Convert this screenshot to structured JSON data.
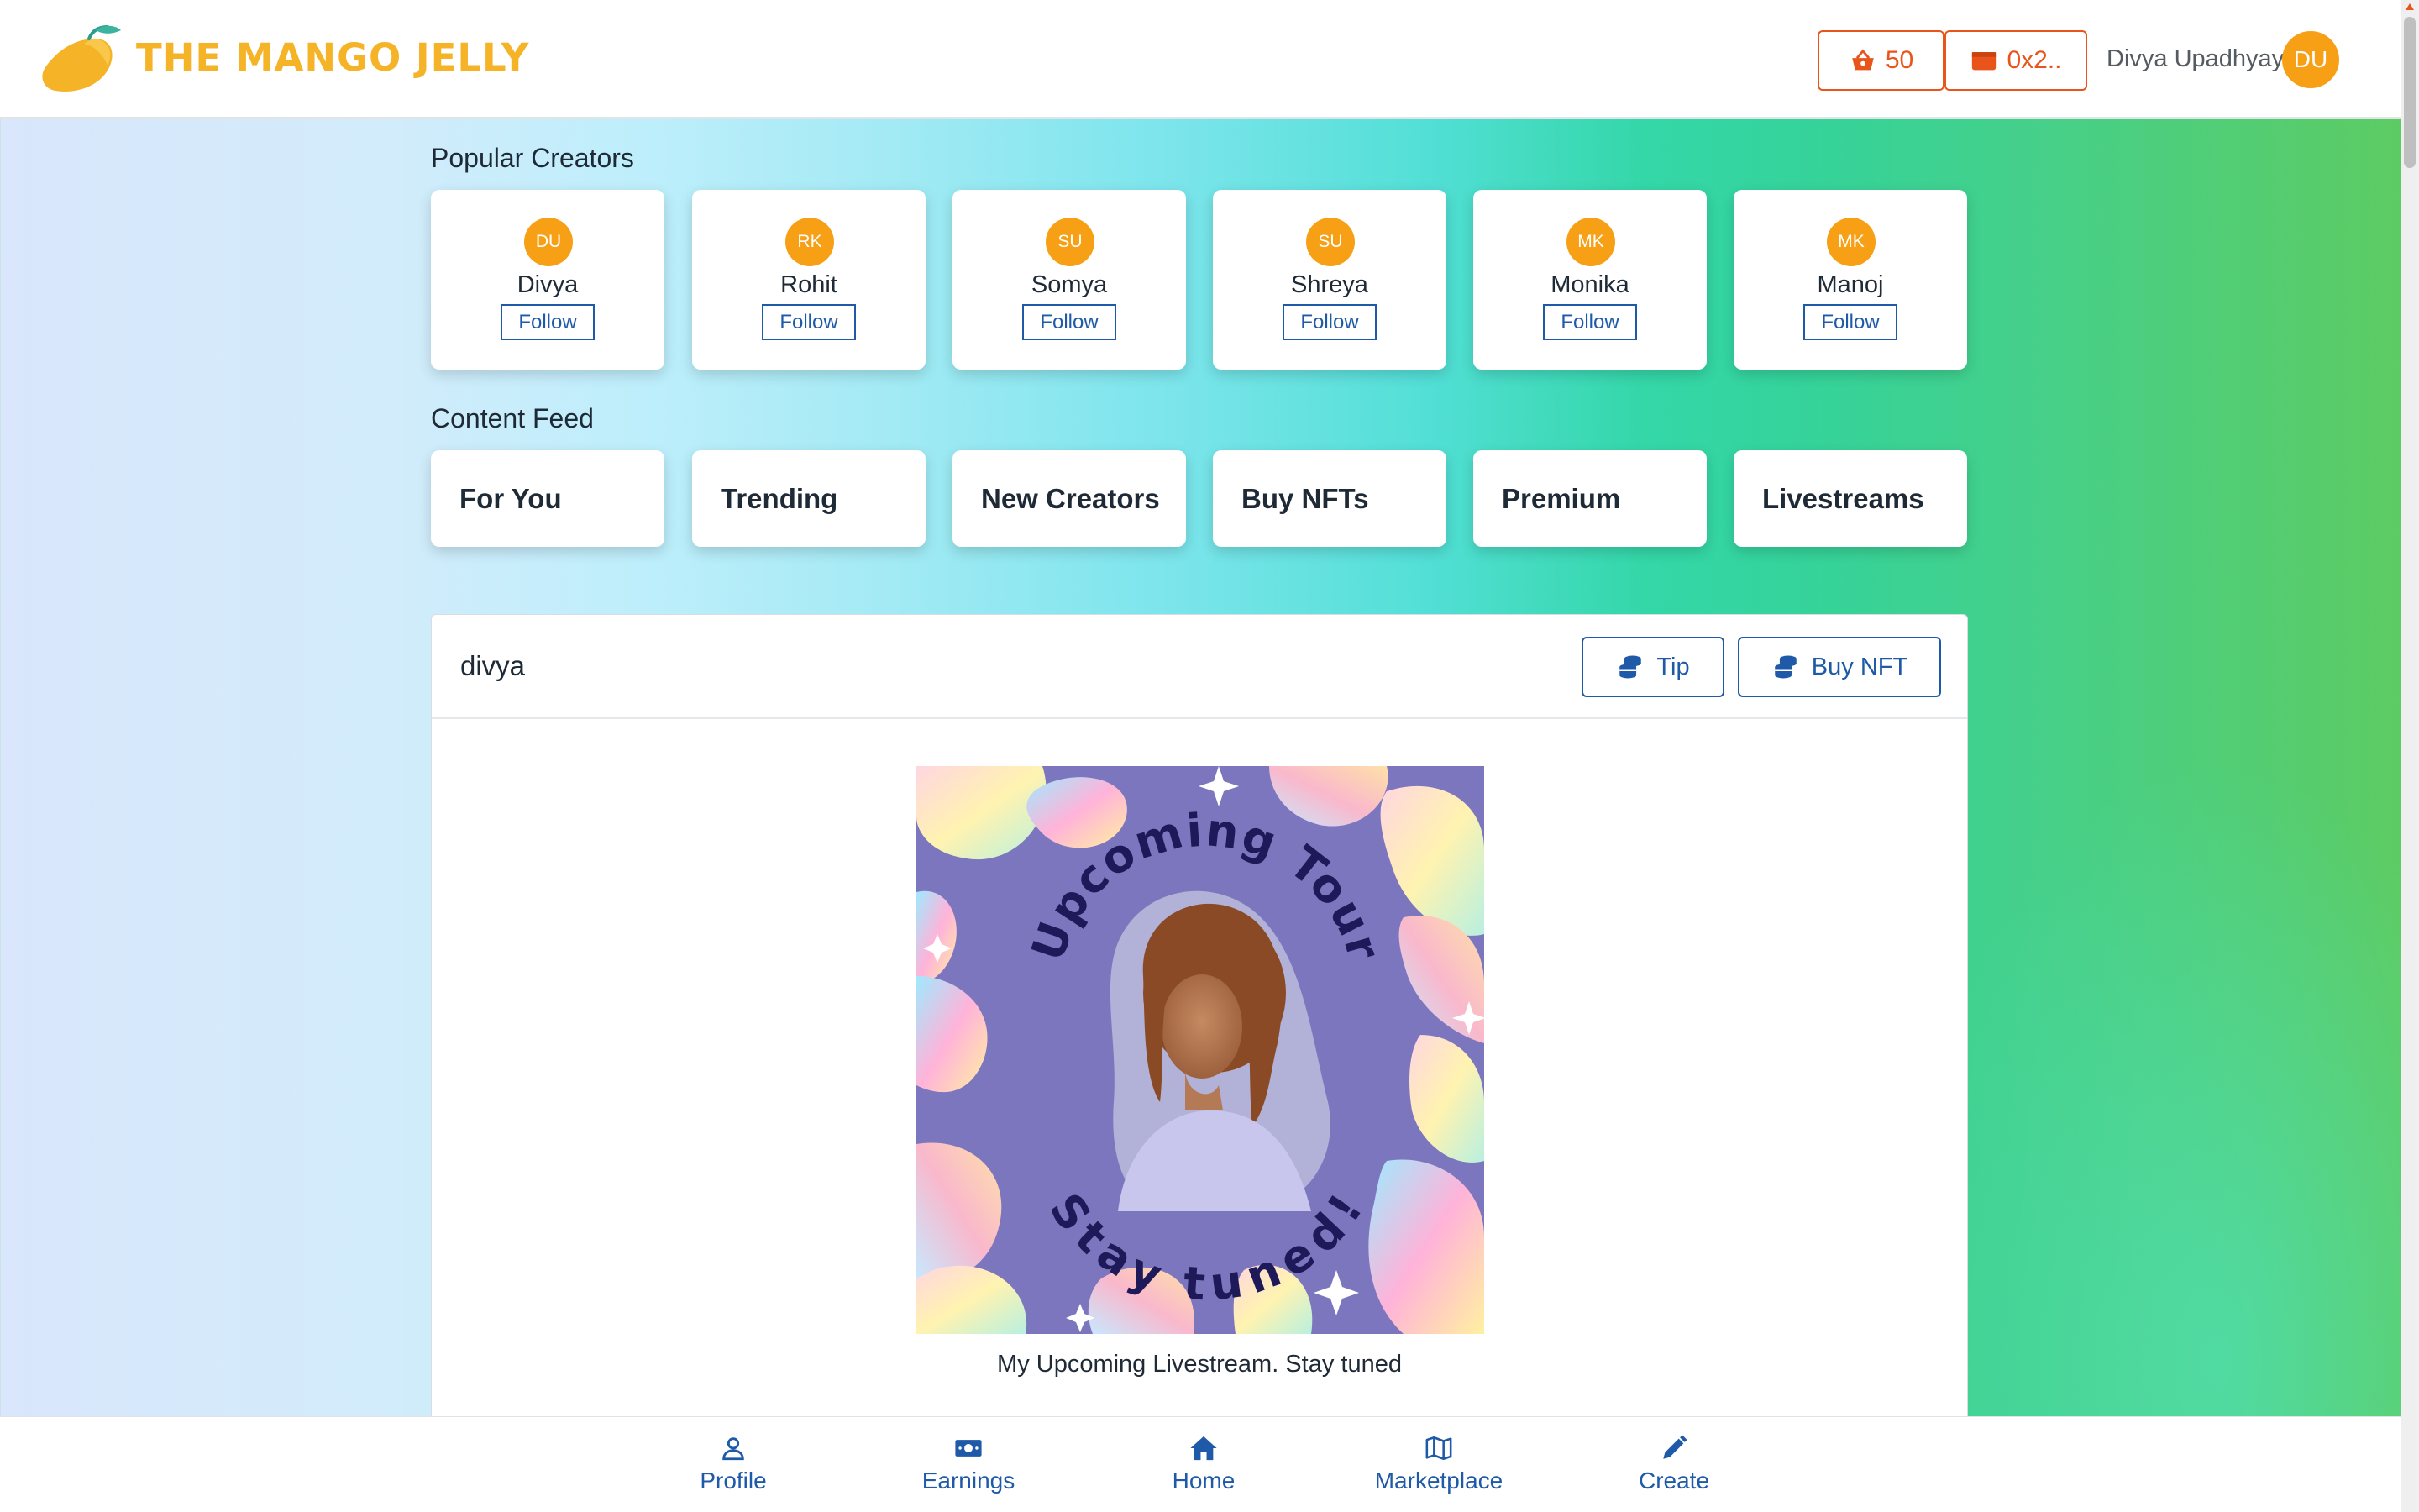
{
  "header": {
    "brand": "THE MANGO JELLY",
    "points": "50",
    "wallet": "0x2..",
    "username": "Divya Upadhyay",
    "avatar_initials": "DU"
  },
  "popular_creators": {
    "title": "Popular Creators",
    "follow_label": "Follow",
    "items": [
      {
        "initials": "DU",
        "name": "Divya",
        "follow": "Follow"
      },
      {
        "initials": "RK",
        "name": "Rohit",
        "follow": "Follow"
      },
      {
        "initials": "SU",
        "name": "Somya",
        "follow": "Follow"
      },
      {
        "initials": "SU",
        "name": "Shreya",
        "follow": "Follow"
      },
      {
        "initials": "MK",
        "name": "Monika",
        "follow": "Follow"
      },
      {
        "initials": "MK",
        "name": "Manoj",
        "follow": "Follow"
      }
    ]
  },
  "content_feed": {
    "title": "Content Feed",
    "tabs": [
      {
        "label": "For You"
      },
      {
        "label": "Trending"
      },
      {
        "label": "New Creators"
      },
      {
        "label": "Buy NFTs"
      },
      {
        "label": "Premium"
      },
      {
        "label": "Livestreams"
      }
    ]
  },
  "post": {
    "author": "divya",
    "tip_label": "Tip",
    "buy_nft_label": "Buy NFT",
    "image_text_top": "Upcoming Tour",
    "image_text_bottom": "Stay tuned!",
    "caption": "My Upcoming Livestream. Stay tuned"
  },
  "bottom_nav": [
    {
      "label": "Profile",
      "icon": "person-icon"
    },
    {
      "label": "Earnings",
      "icon": "money-icon"
    },
    {
      "label": "Home",
      "icon": "house-icon"
    },
    {
      "label": "Marketplace",
      "icon": "map-icon"
    },
    {
      "label": "Create",
      "icon": "pencil-icon"
    }
  ],
  "colors": {
    "accent_orange": "#e8541a",
    "brand_yellow": "#f5b428",
    "avatar_orange": "#f7a015",
    "link_blue": "#1e5aa8"
  }
}
